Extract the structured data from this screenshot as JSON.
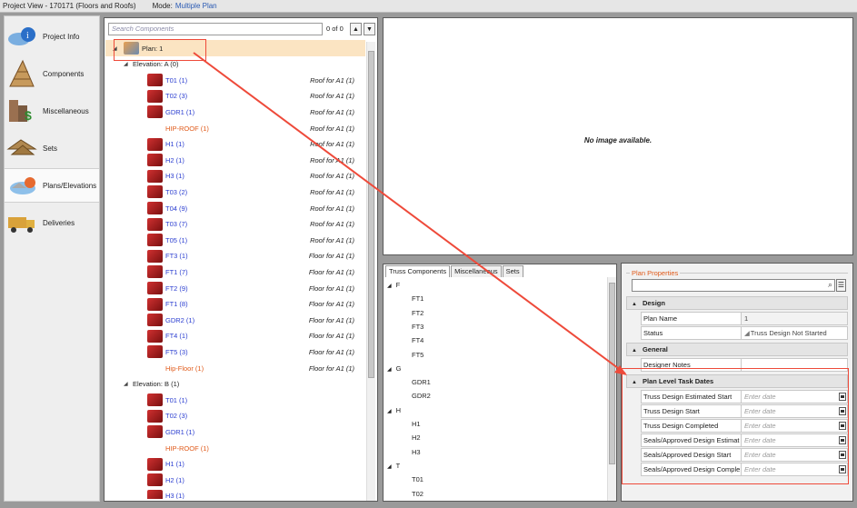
{
  "titlebar": {
    "title": "Project View - 170171 (Floors and Roofs)",
    "mode_label": "Mode:",
    "mode_value": "Multiple Plan"
  },
  "nav": [
    {
      "label": "Project Info",
      "icon": "project-info-icon"
    },
    {
      "label": "Components",
      "icon": "components-icon"
    },
    {
      "label": "Miscellaneous",
      "icon": "miscellaneous-icon"
    },
    {
      "label": "Sets",
      "icon": "sets-icon"
    },
    {
      "label": "Plans/Elevations",
      "icon": "plans-elevations-icon",
      "active": true
    },
    {
      "label": "Deliveries",
      "icon": "deliveries-icon"
    }
  ],
  "tree": {
    "search_placeholder": "Search Components",
    "count": "0 of 0",
    "rows": [
      {
        "level": 0,
        "text": "Plan:  1",
        "desc": "",
        "color": "dark",
        "exp": "◢",
        "icon": true
      },
      {
        "level": 1,
        "text": "Elevation:  A (0)",
        "desc": "",
        "color": "dark",
        "exp": "◢",
        "icon": false
      },
      {
        "level": 2,
        "text": "T01 (1)",
        "desc": "Roof for A1 (1)",
        "color": "blue",
        "icon": true
      },
      {
        "level": 2,
        "text": "T02 (3)",
        "desc": "Roof for A1 (1)",
        "color": "blue",
        "icon": true
      },
      {
        "level": 2,
        "text": "GDR1 (1)",
        "desc": "Roof for A1 (1)",
        "color": "blue",
        "icon": true
      },
      {
        "level": 2,
        "text": "HIP-ROOF (1)",
        "desc": "Roof for A1 (1)",
        "color": "orange",
        "icon": false
      },
      {
        "level": 2,
        "text": "H1 (1)",
        "desc": "Roof for A1 (1)",
        "color": "blue",
        "icon": true
      },
      {
        "level": 2,
        "text": "H2 (1)",
        "desc": "Roof for A1 (1)",
        "color": "blue",
        "icon": true
      },
      {
        "level": 2,
        "text": "H3 (1)",
        "desc": "Roof for A1 (1)",
        "color": "blue",
        "icon": true
      },
      {
        "level": 2,
        "text": "T03 (2)",
        "desc": "Roof for A1 (1)",
        "color": "blue",
        "icon": true
      },
      {
        "level": 2,
        "text": "T04 (9)",
        "desc": "Roof for A1 (1)",
        "color": "blue",
        "icon": true
      },
      {
        "level": 2,
        "text": "T03 (7)",
        "desc": "Roof for A1 (1)",
        "color": "blue",
        "icon": true
      },
      {
        "level": 2,
        "text": "T05 (1)",
        "desc": "Roof for A1 (1)",
        "color": "blue",
        "icon": true
      },
      {
        "level": 2,
        "text": "FT3 (1)",
        "desc": "Floor for A1 (1)",
        "color": "blue",
        "icon": true
      },
      {
        "level": 2,
        "text": "FT1 (7)",
        "desc": "Floor for A1 (1)",
        "color": "blue",
        "icon": true
      },
      {
        "level": 2,
        "text": "FT2 (9)",
        "desc": "Floor for A1 (1)",
        "color": "blue",
        "icon": true
      },
      {
        "level": 2,
        "text": "FT1 (8)",
        "desc": "Floor for A1 (1)",
        "color": "blue",
        "icon": true
      },
      {
        "level": 2,
        "text": "GDR2 (1)",
        "desc": "Floor for A1 (1)",
        "color": "blue",
        "icon": true
      },
      {
        "level": 2,
        "text": "FT4 (1)",
        "desc": "Floor for A1 (1)",
        "color": "blue",
        "icon": true
      },
      {
        "level": 2,
        "text": "FT5 (3)",
        "desc": "Floor for A1 (1)",
        "color": "blue",
        "icon": true
      },
      {
        "level": 2,
        "text": "Hip-Floor (1)",
        "desc": "Floor for A1 (1)",
        "color": "orange",
        "icon": false
      },
      {
        "level": 1,
        "text": "Elevation:  B (1)",
        "desc": "",
        "color": "dark",
        "exp": "◢",
        "icon": false
      },
      {
        "level": 2,
        "text": "T01 (1)",
        "desc": "",
        "color": "blue",
        "icon": true
      },
      {
        "level": 2,
        "text": "T02 (3)",
        "desc": "",
        "color": "blue",
        "icon": true
      },
      {
        "level": 2,
        "text": "GDR1 (1)",
        "desc": "",
        "color": "blue",
        "icon": true
      },
      {
        "level": 2,
        "text": "HIP-ROOF (1)",
        "desc": "",
        "color": "orange",
        "icon": false
      },
      {
        "level": 2,
        "text": "H1 (1)",
        "desc": "",
        "color": "blue",
        "icon": true
      },
      {
        "level": 2,
        "text": "H2 (1)",
        "desc": "",
        "color": "blue",
        "icon": true
      },
      {
        "level": 2,
        "text": "H3 (1)",
        "desc": "",
        "color": "blue",
        "icon": true
      }
    ]
  },
  "image_panel": {
    "text": "No image available."
  },
  "comp_panel": {
    "tabs": [
      "Truss Components",
      "Miscellaneous",
      "Sets"
    ],
    "rows": [
      {
        "t": "F",
        "g": true
      },
      {
        "t": "FT1"
      },
      {
        "t": "FT2"
      },
      {
        "t": "FT3"
      },
      {
        "t": "FT4"
      },
      {
        "t": "FT5"
      },
      {
        "t": "G",
        "g": true
      },
      {
        "t": "GDR1"
      },
      {
        "t": "GDR2"
      },
      {
        "t": "H",
        "g": true
      },
      {
        "t": "H1"
      },
      {
        "t": "H2"
      },
      {
        "t": "H3"
      },
      {
        "t": "T",
        "g": true
      },
      {
        "t": "T01"
      },
      {
        "t": "T02"
      }
    ]
  },
  "props": {
    "title": "Plan Properties",
    "sections": [
      {
        "name": "Design",
        "rows": [
          {
            "l": "Plan Name",
            "v": "1",
            "shade": true
          },
          {
            "l": "Status",
            "v": "Truss Design Not Started",
            "shade": false,
            "icon": true
          }
        ]
      },
      {
        "name": "General",
        "rows": [
          {
            "l": "Designer Notes",
            "v": ""
          }
        ]
      },
      {
        "name": "Plan Level Task Dates",
        "rows": [
          {
            "l": "Truss Design Estimated Start",
            "v": "Enter date",
            "ph": true,
            "cal": true
          },
          {
            "l": "Truss Design Start",
            "v": "Enter date",
            "ph": true,
            "cal": true
          },
          {
            "l": "Truss Design Completed",
            "v": "Enter date",
            "ph": true,
            "cal": true
          },
          {
            "l": "Seals/Approved Design Estimat",
            "v": "Enter date",
            "ph": true,
            "cal": true
          },
          {
            "l": "Seals/Approved Design Start",
            "v": "Enter date",
            "ph": true,
            "cal": true
          },
          {
            "l": "Seals/Approved Design Comple",
            "v": "Enter date",
            "ph": true,
            "cal": true
          }
        ]
      }
    ]
  },
  "colors": {
    "highlight": "#ee4a3a",
    "accent_orange": "#e05a1a",
    "link_blue": "#2a3dd0"
  }
}
